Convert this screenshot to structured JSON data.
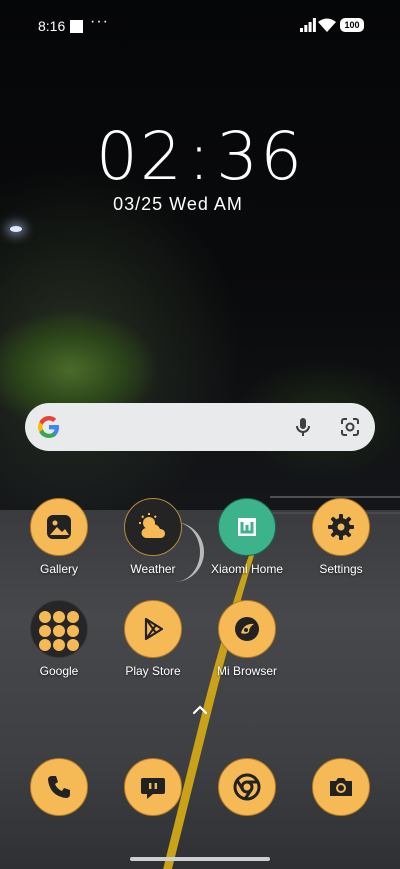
{
  "status_bar": {
    "time": "8:16",
    "more": "···",
    "battery": "100"
  },
  "clock": {
    "hours": "02",
    "minutes": "36",
    "colon": ":",
    "date": "03/25 Wed AM"
  },
  "search": {
    "icons": [
      "google-icon",
      "mic-icon",
      "lens-icon"
    ]
  },
  "apps": [
    {
      "label": "Gallery",
      "icon": "gallery-icon"
    },
    {
      "label": "Weather",
      "icon": "weather-icon"
    },
    {
      "label": "Xiaomi Home",
      "icon": "xiaomi-home-icon"
    },
    {
      "label": "Settings",
      "icon": "gear-icon"
    },
    {
      "label": "Google",
      "icon": "folder-icon"
    },
    {
      "label": "Play Store",
      "icon": "play-store-icon"
    },
    {
      "label": "Mi Browser",
      "icon": "browser-icon"
    }
  ],
  "dock": [
    {
      "icon": "phone-icon"
    },
    {
      "icon": "messages-icon"
    },
    {
      "icon": "chrome-icon"
    },
    {
      "icon": "camera-icon"
    }
  ],
  "colors": {
    "accent": "#f5b956",
    "search_bg": "#e9eaec"
  }
}
